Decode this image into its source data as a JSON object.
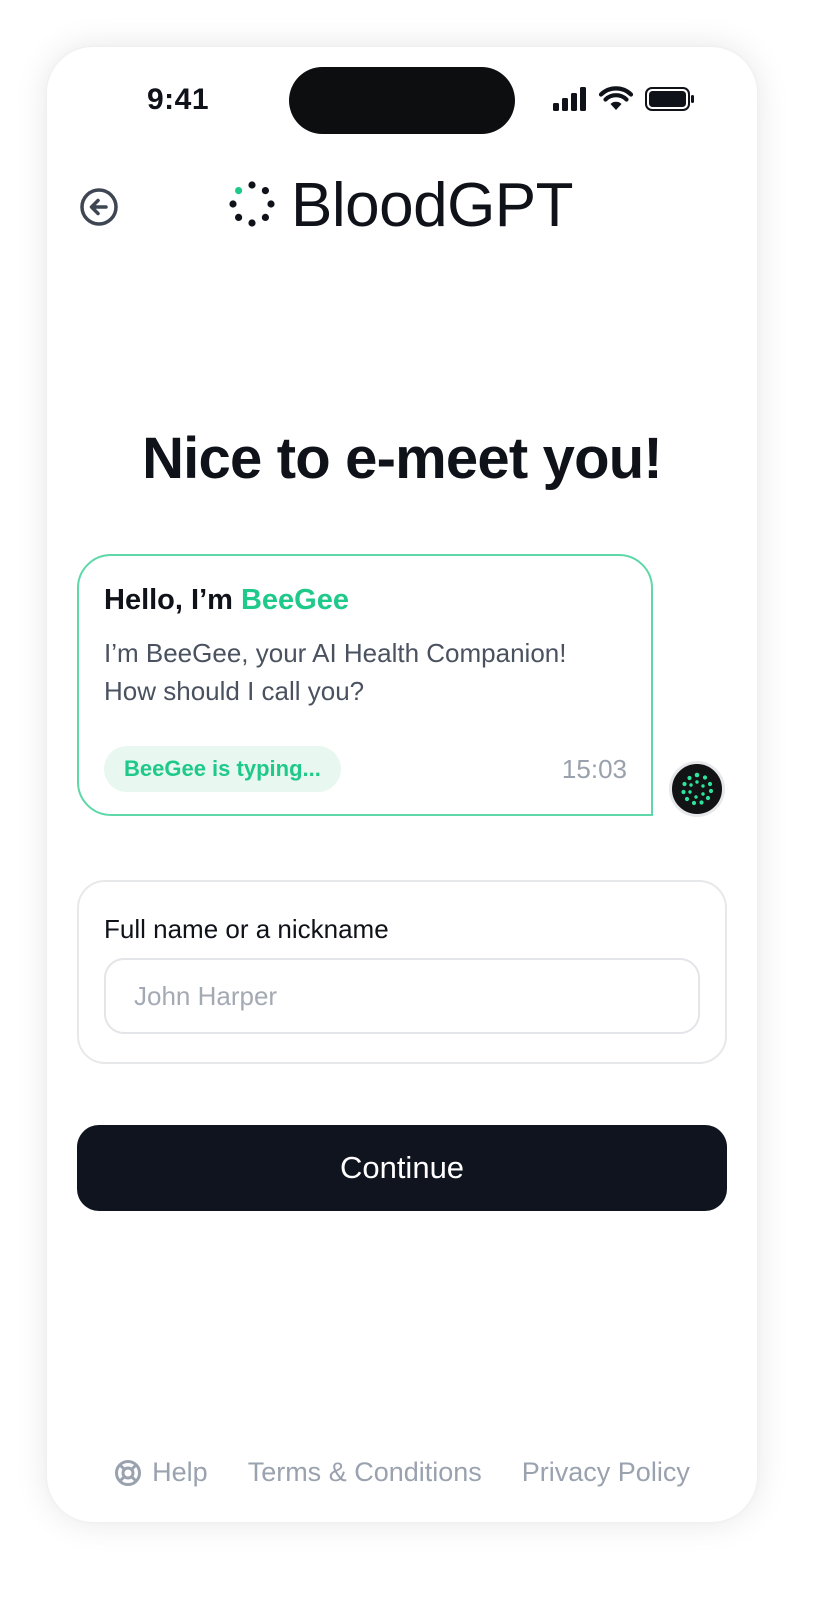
{
  "status_bar": {
    "time": "9:41",
    "icons": [
      "cellular-signal-icon",
      "wifi-icon",
      "battery-icon"
    ]
  },
  "header": {
    "back_icon": "arrow-left-circle-icon",
    "logo_icon": "dotted-circle-logo-icon",
    "logo_text": "BloodGPT"
  },
  "title": "Nice to e-meet you!",
  "chat": {
    "greeting_prefix": "Hello, I’m ",
    "bot_name": "BeeGee",
    "message": "I’m BeeGee, your AI Health Companion! How should I call you?",
    "typing_status": "BeeGee is typing...",
    "timestamp": "15:03",
    "avatar_icon": "bot-avatar-icon"
  },
  "form": {
    "label": "Full name or a nickname",
    "value": "",
    "placeholder": "John Harper"
  },
  "continue_label": "Continue",
  "footer": {
    "help_icon": "lifebuoy-icon",
    "help": "Help",
    "terms": "Terms & Conditions",
    "privacy": "Privacy Policy"
  },
  "colors": {
    "accent": "#1ec98a",
    "accent_border": "#5fd8a9",
    "dark": "#10141e",
    "muted": "#9aa2af"
  }
}
